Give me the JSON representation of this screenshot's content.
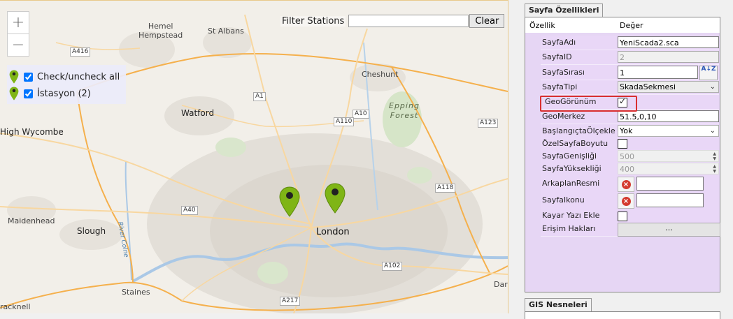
{
  "map": {
    "zoom_in": "+",
    "zoom_out": "−",
    "filter_label": "Filter Stations",
    "filter_value": "",
    "clear_button": "Clear",
    "layers": [
      {
        "label": "Check/uncheck all",
        "checked": true
      },
      {
        "label": "İstasyon (2)",
        "checked": true
      }
    ],
    "places": {
      "hemel": "Hemel\nHempstead",
      "st_albans": "St Albans",
      "cheshunt": "Cheshunt",
      "watford": "Watford",
      "high_wycombe": "High Wycombe",
      "epping": "Epping\nForest",
      "london": "London",
      "maidenhead": "Maidenhead",
      "slough": "Slough",
      "river_colne": "River Colne",
      "staines": "Staines",
      "racknell": "racknell",
      "dartford": "Dart"
    },
    "roads": {
      "a416": "A416",
      "a1": "A1",
      "a10": "A10",
      "a110": "A110",
      "a123": "A123",
      "a118": "A118",
      "a40": "A40",
      "a102": "A102",
      "a217": "A217"
    },
    "markers": [
      "marker-1",
      "marker-2"
    ],
    "marker_color": "#7fb516"
  },
  "properties": {
    "tab_title": "Sayfa Özellikleri",
    "col_property": "Özellik",
    "col_value": "Değer",
    "rows": [
      {
        "name": "SayfaAdı",
        "value": "YeniScada2.sca"
      },
      {
        "name": "SayfaID",
        "value": "2"
      },
      {
        "name": "SayfaSırası",
        "value": "1",
        "sort_icon": "A↓Z"
      },
      {
        "name": "SayfaTipi",
        "value": "SkadaSekmesi"
      },
      {
        "name": "GeoGörünüm",
        "checked": true
      },
      {
        "name": "GeoMerkez",
        "value": "51.5,0,10"
      },
      {
        "name": "BaşlangıçtaÖlçekle",
        "value": "Yok"
      },
      {
        "name": "ÖzelSayfaBoyutu",
        "checked": false
      },
      {
        "name": "SayfaGenişliği",
        "value": "500"
      },
      {
        "name": "SayfaYüksekliği",
        "value": "400"
      },
      {
        "name": "ArkaplanResmi",
        "value": "",
        "dots": "..."
      },
      {
        "name": "SayfaIkonu",
        "value": "",
        "dots": "..."
      },
      {
        "name": "Kayar Yazı Ekle",
        "checked": false
      },
      {
        "name": "Erişim Hakları",
        "button": "..."
      }
    ],
    "highlight_color": "#d93030"
  },
  "gis": {
    "tab_title": "GIS Nesneleri"
  }
}
